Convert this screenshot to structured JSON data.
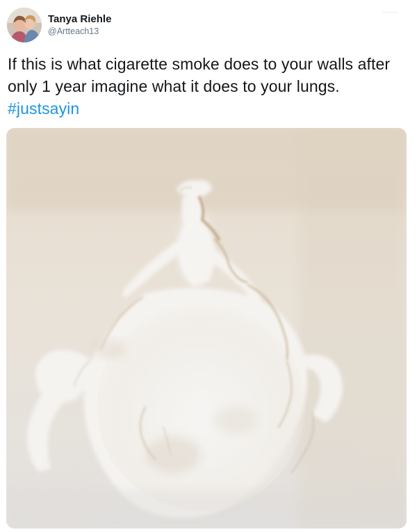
{
  "tweet": {
    "author": {
      "display_name": "Tanya Riehle",
      "handle": "@Artteach13",
      "avatar_icon": "profile-photo-avatar"
    },
    "text": {
      "body": "If this is what cigarette smoke does to your walls after only 1 year imagine what it does to your lungs.",
      "hashtag": "#justsayin"
    },
    "media": {
      "kind": "photo",
      "icon": "wall-photo"
    }
  },
  "colors": {
    "text": "#14171a",
    "secondary": "#657786",
    "link": "#1b95e0",
    "wall_stain": "#c9b497",
    "wall_clean": "#f4f2ee"
  }
}
